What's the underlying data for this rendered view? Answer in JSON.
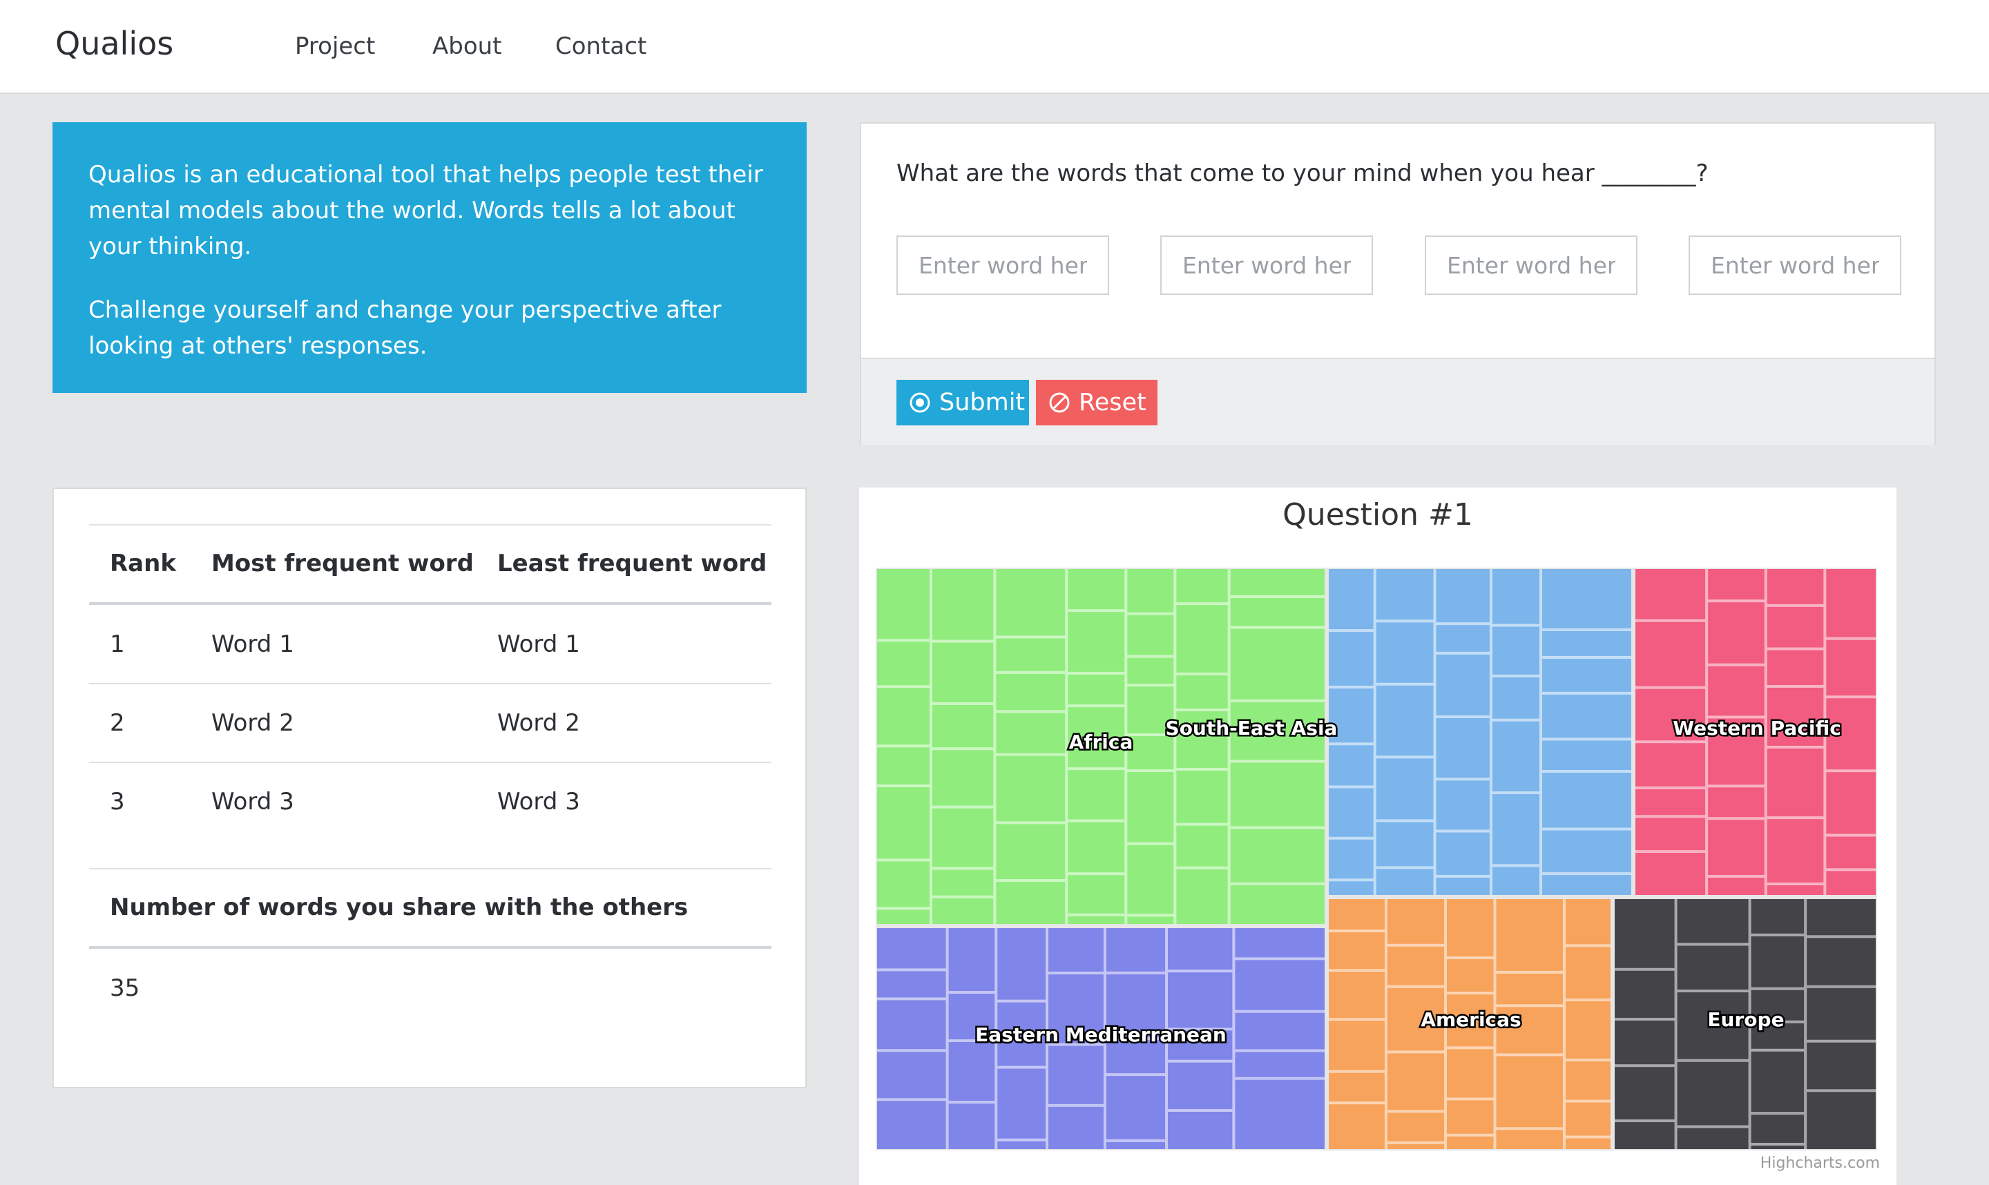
{
  "navbar": {
    "brand": "Qualios",
    "links": [
      "Project",
      "About",
      "Contact"
    ]
  },
  "intro": {
    "paragraph1": "Qualios is an educational tool that helps people test their mental models about the world. Words tells a lot about your thinking.",
    "paragraph2": "Challenge yourself and change your perspective after looking at others' responses."
  },
  "question": {
    "text": "What are the words that come to your mind when you hear ________?",
    "inputs": [
      {
        "placeholder": "Enter word here",
        "value": ""
      },
      {
        "placeholder": "Enter word here",
        "value": ""
      },
      {
        "placeholder": "Enter word here",
        "value": ""
      },
      {
        "placeholder": "Enter word here",
        "value": ""
      }
    ],
    "submit_label": "Submit",
    "reset_label": "Reset",
    "submit_icon": "target-icon",
    "reset_icon": "ban-icon"
  },
  "stats": {
    "headers": [
      "Rank",
      "Most frequent word",
      "Least frequent word"
    ],
    "rows": [
      [
        "1",
        "Word 1",
        "Word 1"
      ],
      [
        "2",
        "Word 2",
        "Word 2"
      ],
      [
        "3",
        "Word 3",
        "Word 3"
      ]
    ],
    "shared_title": "Number of words you share with the others",
    "shared_value": "35"
  },
  "chart": {
    "credit": "Highcharts.com"
  },
  "colors": {
    "accent": "#22a7d9",
    "danger": "#f25f5f"
  },
  "chart_data": {
    "type": "treemap",
    "title": "Question #1",
    "series": [
      {
        "name": "Africa",
        "color": "#90ed7d"
      },
      {
        "name": "South-East Asia",
        "color": "#7cb5ec"
      },
      {
        "name": "Western Pacific",
        "color": "#f15c80"
      },
      {
        "name": "Eastern Mediterranean",
        "color": "#8085e9"
      },
      {
        "name": "Americas",
        "color": "#f7a35c"
      },
      {
        "name": "Europe",
        "color": "#434348"
      }
    ]
  }
}
